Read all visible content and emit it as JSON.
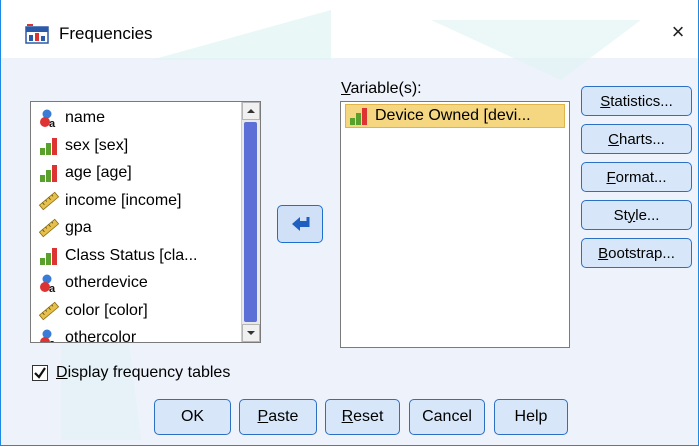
{
  "window": {
    "title": "Frequencies",
    "close_glyph": "×"
  },
  "source_list": {
    "items": [
      {
        "label": "name",
        "icon": "nominal-person-icon"
      },
      {
        "label": "sex [sex]",
        "icon": "ordinal-bar-icon"
      },
      {
        "label": "age [age]",
        "icon": "ordinal-bar-icon"
      },
      {
        "label": "income [income]",
        "icon": "scale-ruler-icon"
      },
      {
        "label": "gpa",
        "icon": "scale-ruler-icon"
      },
      {
        "label": "Class Status [cla...",
        "icon": "ordinal-bar-icon"
      },
      {
        "label": "otherdevice",
        "icon": "nominal-person-icon"
      },
      {
        "label": "color [color]",
        "icon": "scale-ruler-icon"
      },
      {
        "label": "othercolor",
        "icon": "nominal-person-icon"
      }
    ]
  },
  "move_button": {
    "icon": "move-arrow-icon"
  },
  "variables": {
    "label_prefix": "",
    "label_u": "V",
    "label_rest": "ariable(s):",
    "selected": "Device Owned [devi...",
    "selected_icon": "ordinal-bar-icon"
  },
  "side_buttons": {
    "statistics": {
      "u": "S",
      "rest": "tatistics..."
    },
    "charts": {
      "u": "C",
      "rest": "harts..."
    },
    "format": {
      "u": "F",
      "rest": "ormat..."
    },
    "style": {
      "pre": "St",
      "u": "y",
      "rest": "le..."
    },
    "bootstrap": {
      "u": "B",
      "rest": "ootstrap..."
    }
  },
  "display_tables": {
    "checked": true,
    "u": "D",
    "rest": "isplay frequency tables"
  },
  "bottom_buttons": {
    "ok": "OK",
    "paste": {
      "u": "P",
      "rest": "aste"
    },
    "reset": {
      "u": "R",
      "rest": "eset"
    },
    "cancel": "Cancel",
    "help": "Help"
  },
  "colors": {
    "accent": "#1e88e5",
    "button_bg": "#d7e7f9",
    "selection": "#f5d782",
    "scroll_thumb": "#5b6fd6"
  }
}
